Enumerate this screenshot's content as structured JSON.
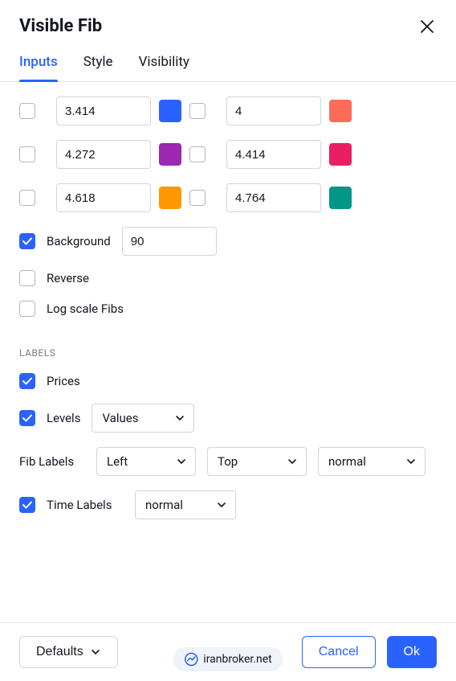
{
  "dialog": {
    "title": "Visible Fib"
  },
  "tabs": {
    "inputs": "Inputs",
    "style": "Style",
    "visibility": "Visibility"
  },
  "fibRows": [
    {
      "val1": "3.414",
      "color1": "#2962ff",
      "val2": "4",
      "color2": "#ff6b5a"
    },
    {
      "val1": "4.272",
      "color1": "#9c27b0",
      "val2": "4.414",
      "color2": "#e91e63"
    },
    {
      "val1": "4.618",
      "color1": "#ff9800",
      "val2": "4.764",
      "color2": "#009688"
    }
  ],
  "options": {
    "backgroundLabel": "Background",
    "backgroundValue": "90",
    "reverseLabel": "Reverse",
    "logScaleLabel": "Log scale Fibs"
  },
  "labels": {
    "header": "LABELS",
    "pricesLabel": "Prices",
    "levelsLabel": "Levels",
    "levelsSelect": "Values",
    "fibLabelsLabel": "Fib Labels",
    "fibLabelsHoriz": "Left",
    "fibLabelsVert": "Top",
    "fibLabelsWeight": "normal",
    "timeLabelsLabel": "Time Labels",
    "timeLabelsWeight": "normal"
  },
  "footer": {
    "defaults": "Defaults",
    "cancel": "Cancel",
    "ok": "Ok"
  },
  "watermark": "iranbroker.net"
}
